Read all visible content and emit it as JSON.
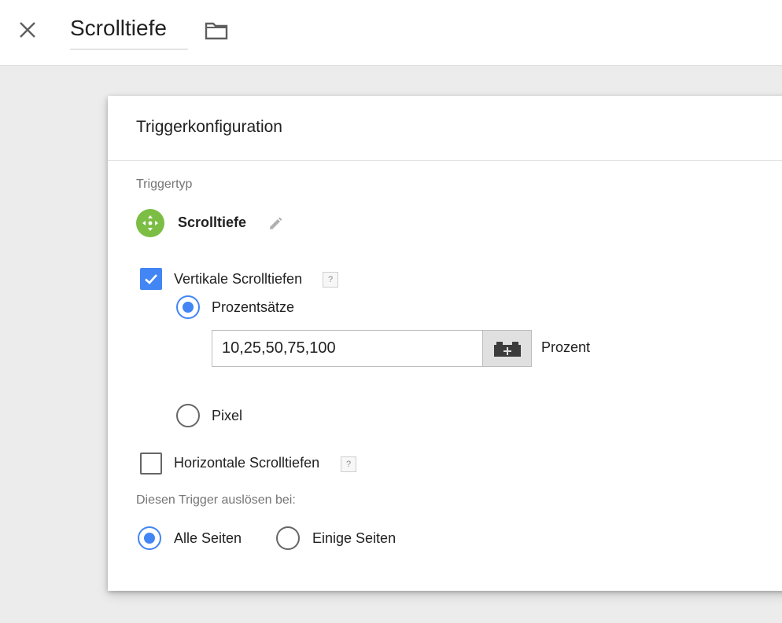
{
  "header": {
    "title": "Scrolltiefe",
    "close_icon": "close-icon",
    "folder_icon": "folder-icon"
  },
  "card": {
    "title": "Triggerkonfiguration",
    "trigger_type_label": "Triggertyp",
    "trigger_type_name": "Scrolltiefe",
    "trigger_icon_color": "#7cbd44",
    "vertical": {
      "label": "Vertikale Scrolltiefen",
      "checked": true,
      "help": "?",
      "percent_option": {
        "label": "Prozentsätze",
        "selected": true
      },
      "percent_value": "10,25,50,75,100",
      "percent_unit": "Prozent",
      "pixel_option": {
        "label": "Pixel",
        "selected": false
      }
    },
    "horizontal": {
      "label": "Horizontale Scrolltiefen",
      "checked": false,
      "help": "?"
    },
    "fire_on_label": "Diesen Trigger auslösen bei:",
    "fire_on_options": [
      {
        "label": "Alle Seiten",
        "selected": true
      },
      {
        "label": "Einige Seiten",
        "selected": false
      }
    ]
  },
  "colors": {
    "accent": "#4285f4",
    "background": "#ececec"
  }
}
